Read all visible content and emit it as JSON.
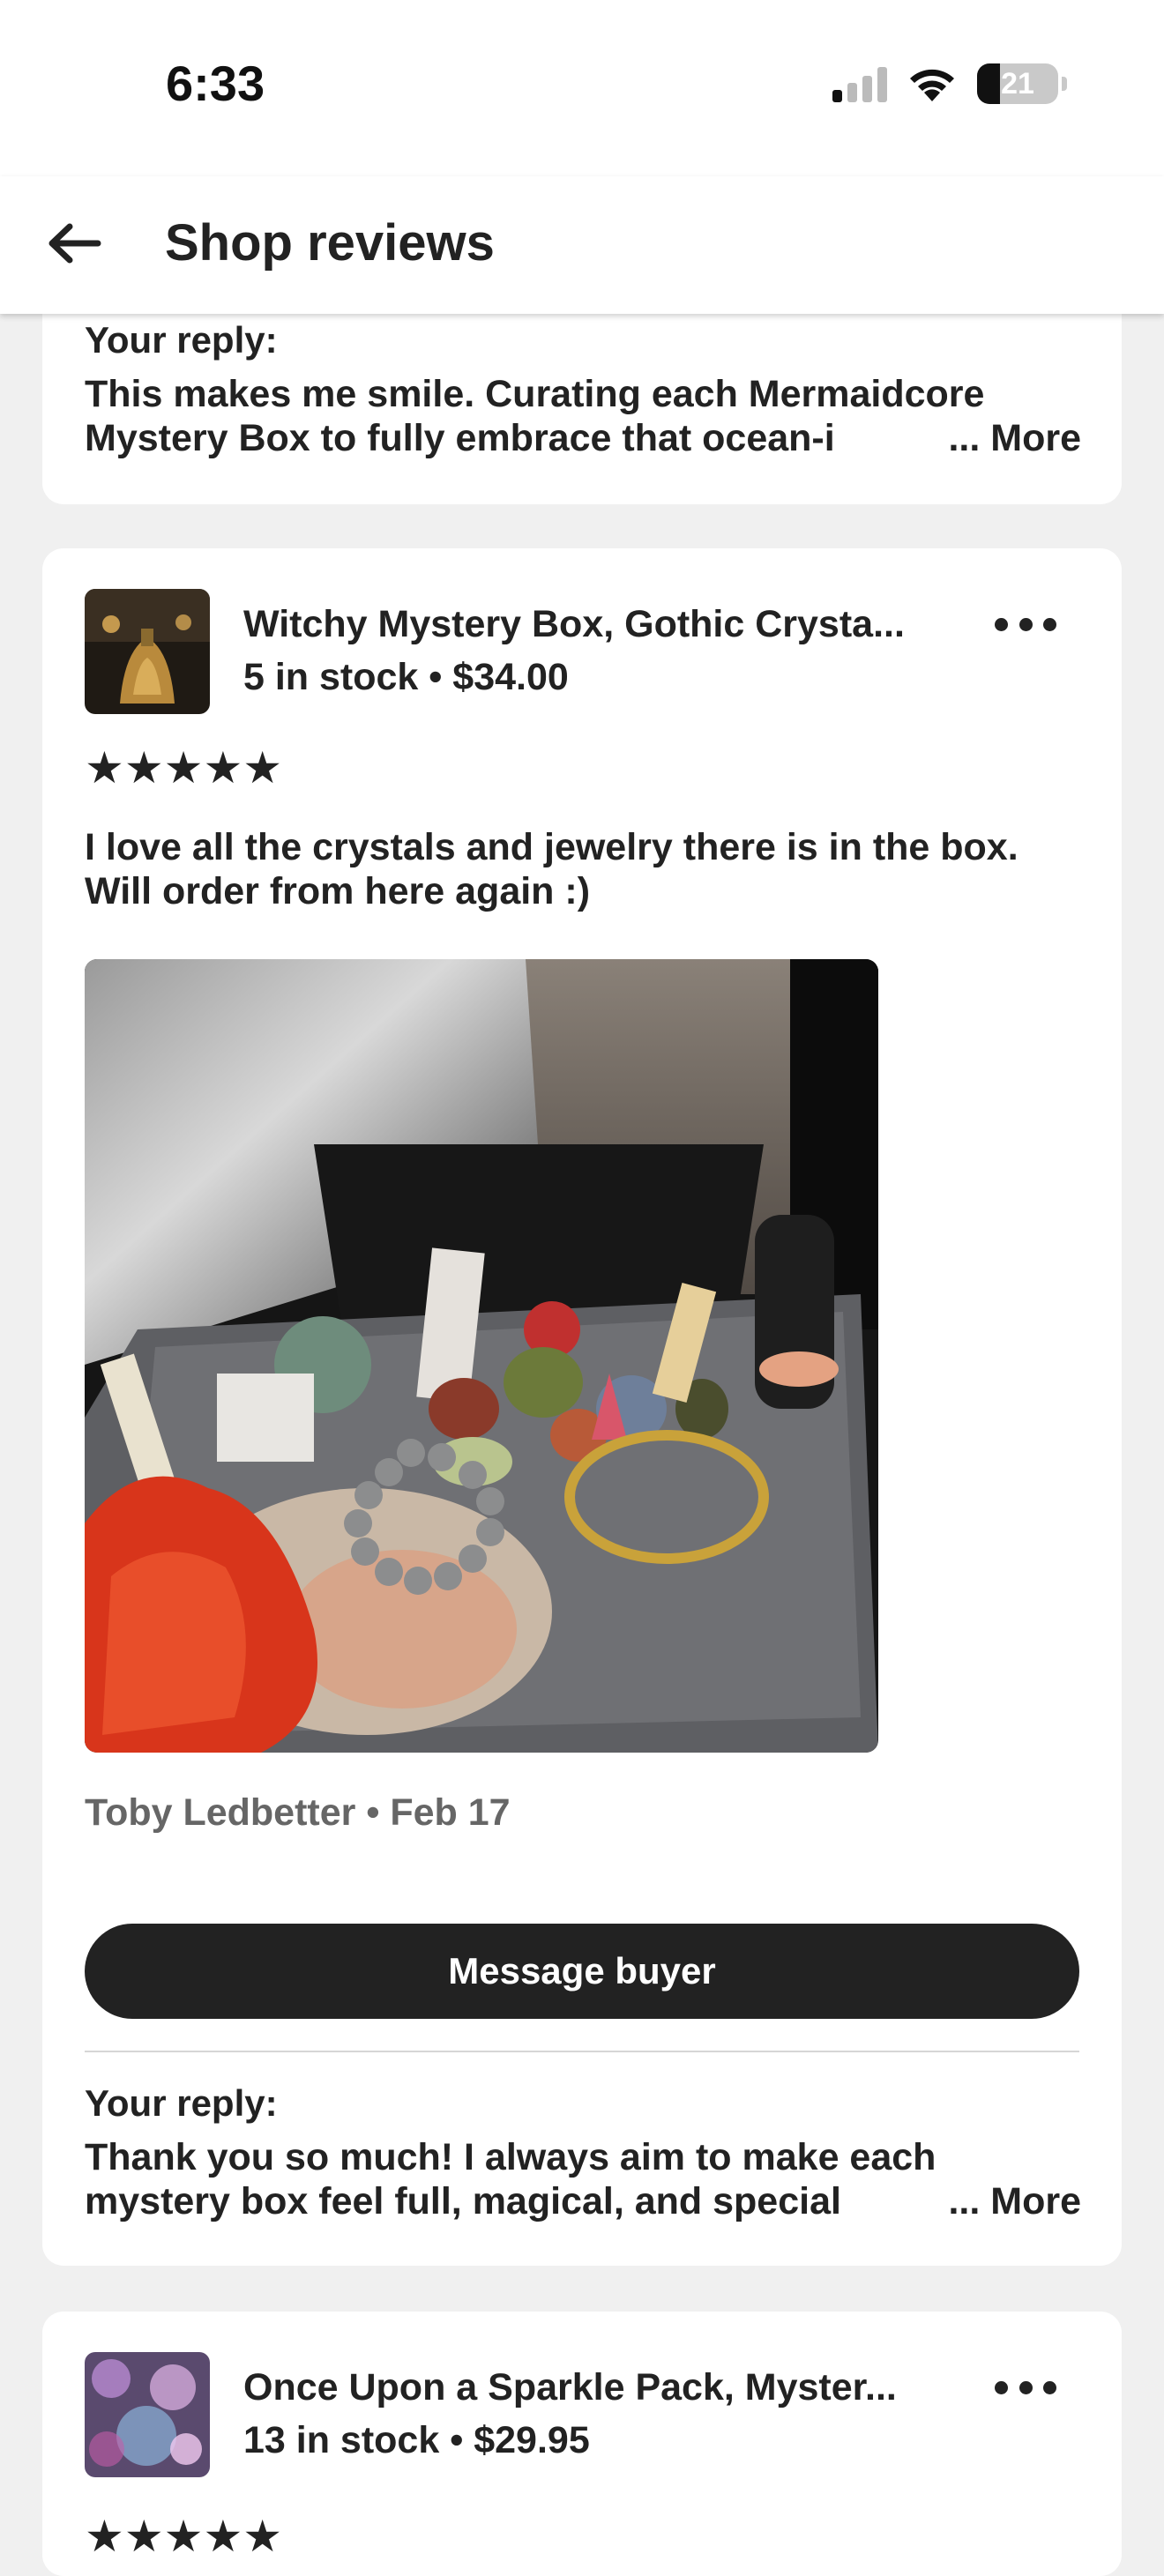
{
  "status": {
    "time": "6:33",
    "battery": "21"
  },
  "header": {
    "title": "Shop reviews"
  },
  "previous_review": {
    "reply_label": "Your reply:",
    "reply_text": "This makes me smile. Curating each Mermaidcore Mystery Box to fully embrace that ocean-i",
    "more_label": "... More"
  },
  "review": {
    "listing_title": "Witchy Mystery Box, Gothic Crysta...",
    "listing_meta": "5 in stock • $34.00",
    "rating": 5,
    "stars": "★★★★★",
    "text": "I love all the crystals and jewelry there is in the box. Will order from here again :)",
    "byline": "Toby Ledbetter • Feb 17",
    "message_button": "Message buyer",
    "reply_label": "Your reply:",
    "reply_text": "Thank you so much! I always aim to make each mystery box feel full, magical, and special",
    "more_label": "... More"
  },
  "next_review": {
    "listing_title": "Once Upon a Sparkle Pack, Myster...",
    "listing_meta": "13 in stock • $29.95",
    "stars": "★★★★★"
  },
  "icons": {
    "back": "arrow-left-icon",
    "options": "more-options-icon",
    "signal": "cellular-signal-icon",
    "wifi": "wifi-icon",
    "battery": "battery-icon"
  }
}
